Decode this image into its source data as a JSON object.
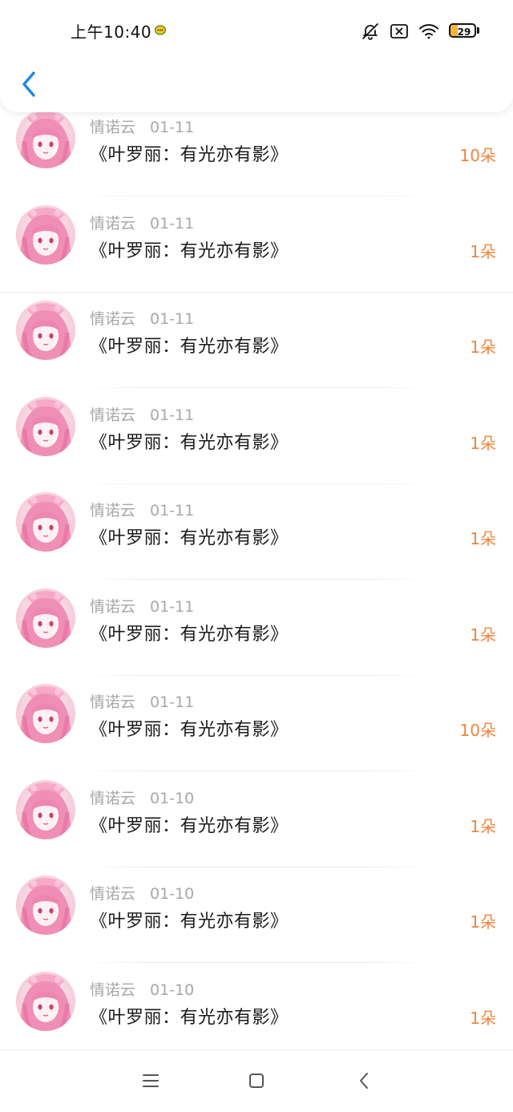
{
  "status_bar": {
    "time": "上午10:40",
    "battery_level": "29",
    "battery_fraction": 0.29,
    "notification_app_icon": "chat-bubble-icon",
    "icons": [
      "mute-bell-icon",
      "sim-off-icon",
      "wifi-icon",
      "battery-icon"
    ]
  },
  "nav": {
    "back_icon": "chevron-left-icon"
  },
  "colors": {
    "accent_blue": "#1e88e5",
    "count_orange": "#f0843a",
    "meta_gray": "#a8a8a8",
    "title_black": "#1a1a1a",
    "battery_yellow": "#f2b634"
  },
  "list": {
    "items": [
      {
        "name": "情诺云",
        "date": "01-11",
        "title": "《叶罗丽：有光亦有影》",
        "count": "10朵"
      },
      {
        "name": "情诺云",
        "date": "01-11",
        "title": "《叶罗丽：有光亦有影》",
        "count": "1朵"
      },
      {
        "name": "情诺云",
        "date": "01-11",
        "title": "《叶罗丽：有光亦有影》",
        "count": "1朵"
      },
      {
        "name": "情诺云",
        "date": "01-11",
        "title": "《叶罗丽：有光亦有影》",
        "count": "1朵"
      },
      {
        "name": "情诺云",
        "date": "01-11",
        "title": "《叶罗丽：有光亦有影》",
        "count": "1朵"
      },
      {
        "name": "情诺云",
        "date": "01-11",
        "title": "《叶罗丽：有光亦有影》",
        "count": "1朵"
      },
      {
        "name": "情诺云",
        "date": "01-11",
        "title": "《叶罗丽：有光亦有影》",
        "count": "10朵"
      },
      {
        "name": "情诺云",
        "date": "01-10",
        "title": "《叶罗丽：有光亦有影》",
        "count": "1朵"
      },
      {
        "name": "情诺云",
        "date": "01-10",
        "title": "《叶罗丽：有光亦有影》",
        "count": "1朵"
      },
      {
        "name": "情诺云",
        "date": "01-10",
        "title": "《叶罗丽：有光亦有影》",
        "count": "1朵"
      }
    ]
  },
  "system_nav": {
    "icons": [
      "menu-icon",
      "home-square-icon",
      "back-triangle-icon"
    ]
  }
}
